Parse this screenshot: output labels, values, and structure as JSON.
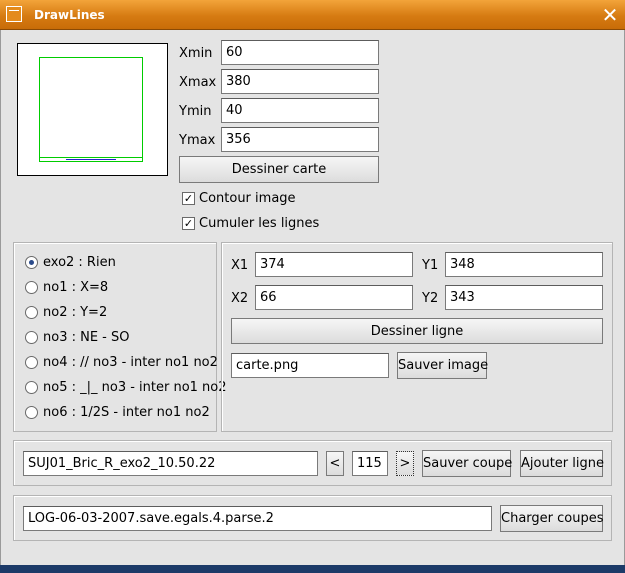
{
  "window": {
    "title": "DrawLines",
    "close_glyph": "✕"
  },
  "bounds": {
    "xmin_label": "Xmin",
    "xmin": "60",
    "xmax_label": "Xmax",
    "xmax": "380",
    "ymin_label": "Ymin",
    "ymin": "40",
    "ymax_label": "Ymax",
    "ymax": "356",
    "draw_map_button": "Dessiner carte"
  },
  "options": {
    "contour_label": "Contour image",
    "contour_checked": true,
    "cumulate_label": "Cumuler les lignes",
    "cumulate_checked": true
  },
  "modes": [
    {
      "label": "exo2 : Rien",
      "selected": true
    },
    {
      "label": "no1 : X=8",
      "selected": false
    },
    {
      "label": "no2 : Y=2",
      "selected": false
    },
    {
      "label": "no3 : NE - SO",
      "selected": false
    },
    {
      "label": "no4 : // no3 - inter no1 no2",
      "selected": false
    },
    {
      "label": "no5 : _|_ no3 - inter no1 no2",
      "selected": false
    },
    {
      "label": "no6 : 1/2S - inter no1 no2",
      "selected": false
    }
  ],
  "line": {
    "x1_label": "X1",
    "x1": "374",
    "y1_label": "Y1",
    "y1": "348",
    "x2_label": "X2",
    "x2": "66",
    "y2_label": "Y2",
    "y2": "343",
    "draw_line_button": "Dessiner ligne",
    "image_file": "carte.png",
    "save_image_button": "Sauver image"
  },
  "cut": {
    "name": "SUJ01_Bric_R_exo2_10.50.22",
    "prev_button": "<",
    "index": "115",
    "next_button": ">",
    "save_cut_button": "Sauver coupe",
    "add_line_button": "Ajouter ligne"
  },
  "log": {
    "file": "LOG-06-03-2007.save.egals.4.parse.2",
    "load_cuts_button": "Charger coupes"
  },
  "colors": {
    "titlebar": "#e08a1c",
    "preview_line": "#00cc00",
    "preview_accent": "#2222cc"
  }
}
